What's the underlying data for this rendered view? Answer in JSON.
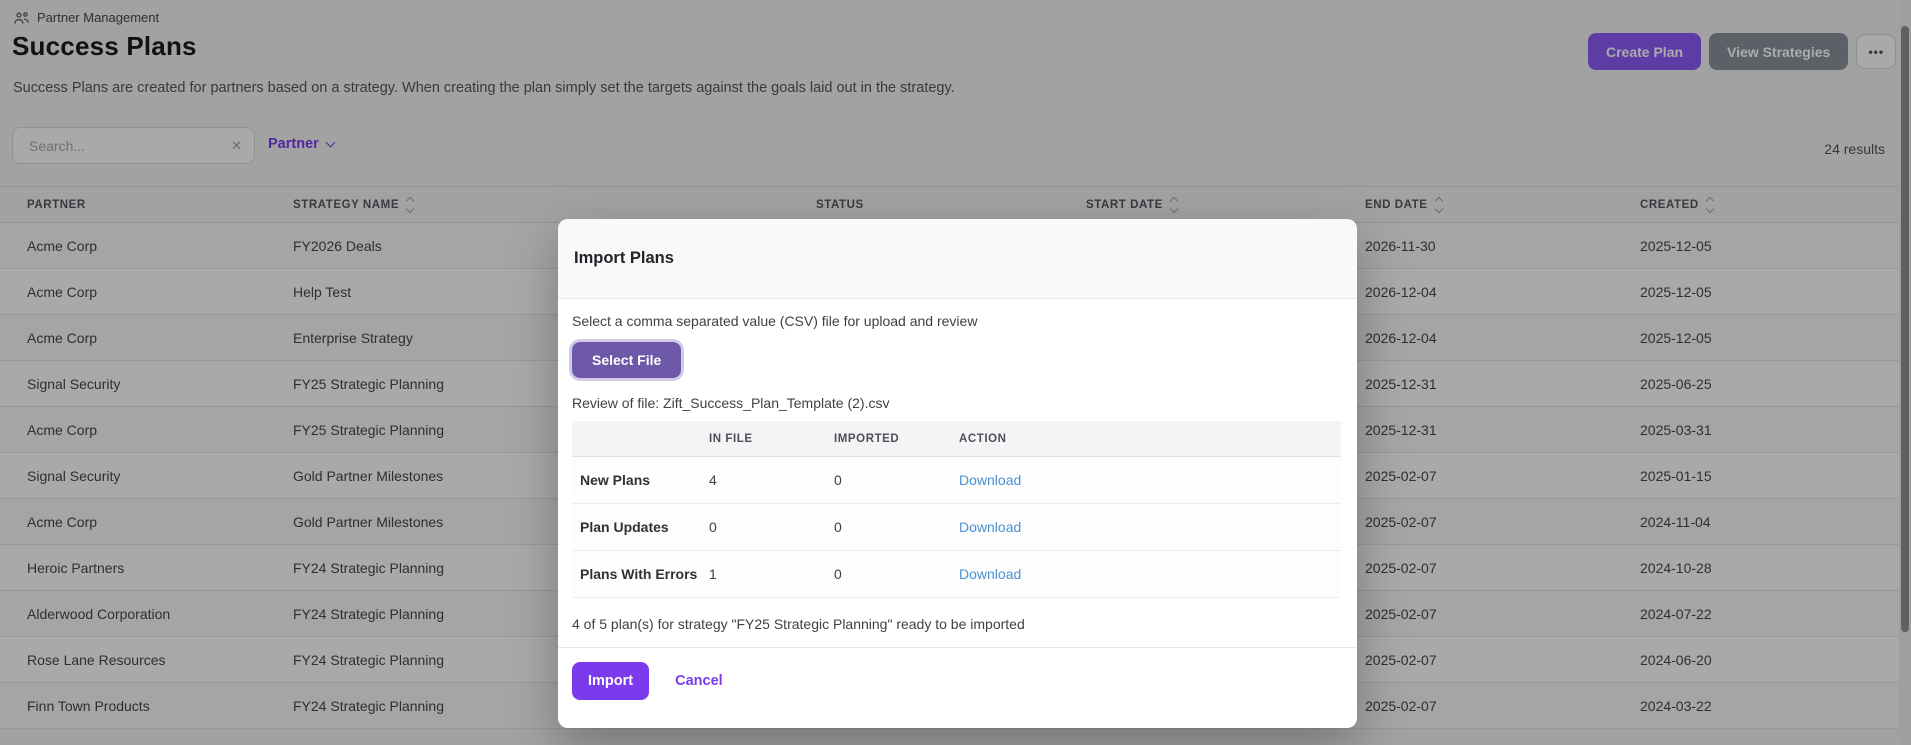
{
  "header": {
    "breadcrumb": "Partner Management",
    "title": "Success Plans",
    "subtitle": "Success Plans are created for partners based on a strategy. When creating the plan simply set the targets against the goals laid out in the strategy.",
    "actions": {
      "create_plan": "Create Plan",
      "view_strategies": "View Strategies",
      "more": "•••"
    }
  },
  "toolbar": {
    "search_placeholder": "Search...",
    "clear_icon": "✕",
    "partner_filter": "Partner",
    "results_count": "24 results"
  },
  "table": {
    "columns": [
      {
        "label": "PARTNER",
        "sortable": false
      },
      {
        "label": "STRATEGY NAME",
        "sortable": true
      },
      {
        "label": "STATUS",
        "sortable": false
      },
      {
        "label": "START DATE",
        "sortable": true
      },
      {
        "label": "END DATE",
        "sortable": true
      },
      {
        "label": "CREATED",
        "sortable": true
      }
    ],
    "rows": [
      {
        "partner": "Acme Corp",
        "strategy_name": "FY2026 Deals",
        "status": "",
        "start_date": "",
        "end_date": "2026-11-30",
        "created": "2025-12-05"
      },
      {
        "partner": "Acme Corp",
        "strategy_name": "Help Test",
        "status": "",
        "start_date": "",
        "end_date": "2026-12-04",
        "created": "2025-12-05"
      },
      {
        "partner": "Acme Corp",
        "strategy_name": "Enterprise Strategy",
        "status": "",
        "start_date": "",
        "end_date": "2026-12-04",
        "created": "2025-12-05"
      },
      {
        "partner": "Signal Security",
        "strategy_name": "FY25 Strategic Planning",
        "status": "",
        "start_date": "",
        "end_date": "2025-12-31",
        "created": "2025-06-25"
      },
      {
        "partner": "Acme Corp",
        "strategy_name": "FY25 Strategic Planning",
        "status": "",
        "start_date": "",
        "end_date": "2025-12-31",
        "created": "2025-03-31"
      },
      {
        "partner": "Signal Security",
        "strategy_name": "Gold Partner Milestones",
        "status": "",
        "start_date": "",
        "end_date": "2025-02-07",
        "created": "2025-01-15"
      },
      {
        "partner": "Acme Corp",
        "strategy_name": "Gold Partner Milestones",
        "status": "",
        "start_date": "",
        "end_date": "2025-02-07",
        "created": "2024-11-04"
      },
      {
        "partner": "Heroic Partners",
        "strategy_name": "FY24 Strategic Planning",
        "status": "",
        "start_date": "",
        "end_date": "2025-02-07",
        "created": "2024-10-28"
      },
      {
        "partner": "Alderwood Corporation",
        "strategy_name": "FY24 Strategic Planning",
        "status": "",
        "start_date": "",
        "end_date": "2025-02-07",
        "created": "2024-07-22"
      },
      {
        "partner": "Rose Lane Resources",
        "strategy_name": "FY24 Strategic Planning",
        "status": "",
        "start_date": "",
        "end_date": "2025-02-07",
        "created": "2024-06-20"
      },
      {
        "partner": "Finn Town Products",
        "strategy_name": "FY24 Strategic Planning",
        "status": "",
        "start_date": "",
        "end_date": "2025-02-07",
        "created": "2024-03-22"
      }
    ]
  },
  "modal": {
    "title": "Import Plans",
    "instruction": "Select a comma separated value (CSV) file for upload and review",
    "select_file_label": "Select File",
    "review_file_label": "Review of file: Zift_Success_Plan_Template (2).csv",
    "review_table": {
      "columns": [
        "",
        "IN FILE",
        "IMPORTED",
        "ACTION"
      ],
      "rows": [
        {
          "label": "New Plans",
          "in_file": "4",
          "imported": "0",
          "action": "Download"
        },
        {
          "label": "Plan Updates",
          "in_file": "0",
          "imported": "0",
          "action": "Download"
        },
        {
          "label": "Plans With Errors",
          "in_file": "1",
          "imported": "0",
          "action": "Download"
        }
      ]
    },
    "summary": "4 of 5 plan(s) for strategy \"FY25 Strategic Planning\" ready to be imported",
    "import_label": "Import",
    "cancel_label": "Cancel"
  },
  "colors": {
    "accent": "#7c3aed",
    "accent_light": "#8b5cf6",
    "select_file_purple": "#6e59a8",
    "link_blue": "#4a90d2",
    "gray_button": "#8a919c"
  }
}
